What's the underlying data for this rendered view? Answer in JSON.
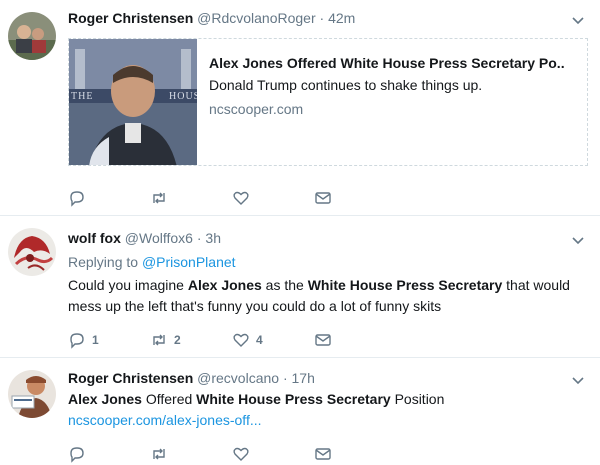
{
  "tweets": [
    {
      "name": "Roger Christensen",
      "handle": "@RdcvolanoRoger",
      "separator": "·",
      "time": "42m",
      "card": {
        "title": "Alex Jones Offered White House Press Secretary Po..",
        "description": "Donald Trump continues to shake things up.",
        "domain": "ncscooper.com",
        "thumb_text_left": "THE",
        "thumb_text_right": "HOUS"
      }
    },
    {
      "name": "wolf fox",
      "handle": "@Wolffox6",
      "separator": "·",
      "time": "3h",
      "replying_prefix": "Replying to",
      "replying_handle": "@PrisonPlanet",
      "text": {
        "p1": "Could you imagine ",
        "b1": "Alex Jones",
        "p2": " as the ",
        "b2": "White House Press Secretary",
        "p3": " that would mess up the left that's funny you could do a lot of funny skits"
      },
      "reply_count": "1",
      "retweet_count": "2",
      "like_count": "4"
    },
    {
      "name": "Roger Christensen",
      "handle": "@recvolcano",
      "separator": "·",
      "time": "17h",
      "text": {
        "b1": "Alex Jones",
        "p1": " Offered ",
        "b2": "White House Press Secretary",
        "p2": " Position"
      },
      "link": "ncscooper.com/alex-jones-off..."
    }
  ],
  "icons": {
    "reply": "reply-icon",
    "retweet": "retweet-icon",
    "like": "heart-icon",
    "dm": "envelope-icon",
    "caret": "chevron-down-icon"
  },
  "colors": {
    "link": "#1b95e0",
    "secondary": "#657786",
    "divider": "#e6ecf0"
  }
}
